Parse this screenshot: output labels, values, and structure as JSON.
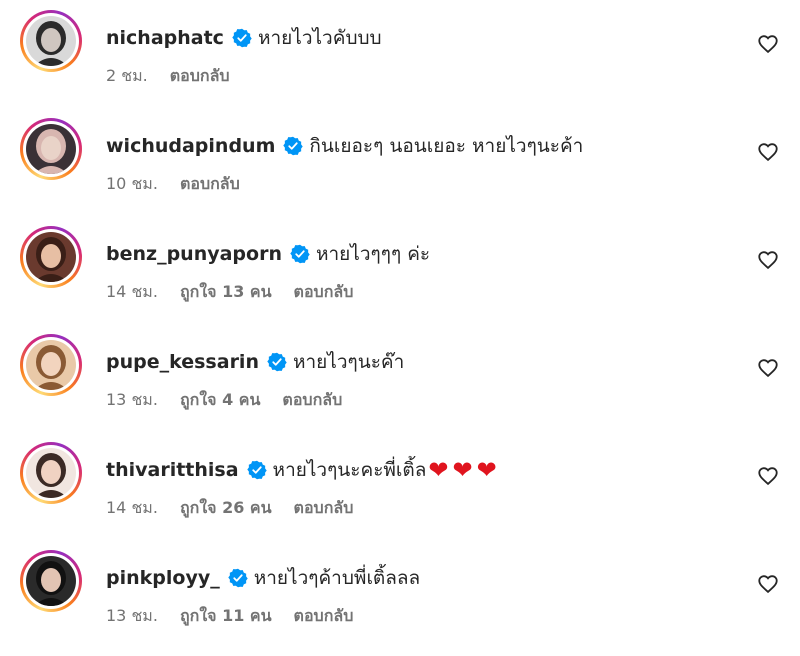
{
  "comments": [
    {
      "username": "nichaphatc",
      "text": "หายไวไวคับบบ",
      "time": "2 ชม.",
      "likes": "",
      "reply": "ตอบกลับ",
      "avatar_bg": "#d9d9d9",
      "avatar_hair": "#2b2b2b",
      "avatar_skin": "#cfc6c0"
    },
    {
      "username": "wichudapindum",
      "text": "กินเยอะๆ นอนเยอะ หายไวๆนะค้า",
      "time": "10 ชม.",
      "likes": "",
      "reply": "ตอบกลับ",
      "avatar_bg": "#3a3136",
      "avatar_hair": "#d8b6b0",
      "avatar_skin": "#e9d3c8"
    },
    {
      "username": "benz_punyaporn",
      "text": "หายไวๆๆๆ ค่ะ",
      "time": "14 ชม.",
      "likes": "ถูกใจ 13 คน",
      "reply": "ตอบกลับ",
      "avatar_bg": "#6a3a2e",
      "avatar_hair": "#3a1f17",
      "avatar_skin": "#e7bfa4"
    },
    {
      "username": "pupe_kessarin",
      "text": "หายไวๆนะค๊า",
      "time": "13 ชม.",
      "likes": "ถูกใจ 4 คน",
      "reply": "ตอบกลับ",
      "avatar_bg": "#e9c9a8",
      "avatar_hair": "#8a5a34",
      "avatar_skin": "#f2d4be"
    },
    {
      "username": "thivaritthisa",
      "text": "หายไวๆนะคะพี่เติ้ล",
      "time": "14 ชม.",
      "likes": "ถูกใจ 26 คน",
      "reply": "ตอบกลับ",
      "hearts": [
        "❤",
        "❤",
        "❤"
      ],
      "avatar_bg": "#f1e6e0",
      "avatar_hair": "#3b2a25",
      "avatar_skin": "#f0d2c2"
    },
    {
      "username": "pinkployy_",
      "text": "หายไวๆค้าบพี่เติ้ลลล",
      "time": "13 ชม.",
      "likes": "ถูกใจ 11 คน",
      "reply": "ตอบกลับ",
      "avatar_bg": "#2a2a2a",
      "avatar_hair": "#111111",
      "avatar_skin": "#e2c4b3"
    }
  ],
  "colors": {
    "verified": "#0095f6",
    "text": "#262626",
    "muted": "#737373",
    "heart_emoji": "#e0141e"
  },
  "icons": {
    "verified": "verified-badge-icon",
    "like": "heart-outline-icon",
    "hearts": "red-heart-emoji"
  }
}
